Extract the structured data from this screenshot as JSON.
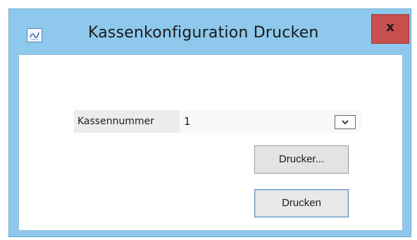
{
  "window": {
    "title": "Kassenkonfiguration Drucken",
    "close_glyph": "x",
    "icon": "app-icon"
  },
  "form": {
    "register_label": "Kassennummer",
    "register_value": "1",
    "dropdown_icon": "chevron-down-icon"
  },
  "buttons": {
    "printer_label": "Drucker...",
    "print_label": "Drucken"
  },
  "colors": {
    "titlebar": "#8ec8ec",
    "close_button": "#c7504f"
  }
}
